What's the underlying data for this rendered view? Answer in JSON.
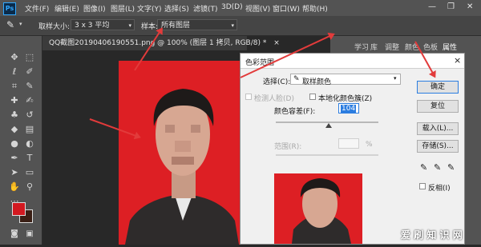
{
  "menubar": {
    "logo": "Ps",
    "items": [
      "文件(F)",
      "编辑(E)",
      "图像(I)",
      "图层(L)",
      "文字(Y)",
      "选择(S)",
      "滤镜(T)",
      "3D(D)",
      "视图(V)",
      "窗口(W)",
      "帮助(H)"
    ],
    "window_buttons": [
      "—",
      "❐",
      "✕"
    ]
  },
  "options": {
    "sample_size_label": "取样大小:",
    "sample_size_value": "3 x 3 平均",
    "sample_label": "样本:",
    "sample_value": "所有图层"
  },
  "document": {
    "tab_title": "QQ截图20190406190551.png @ 100% (图层 1 拷贝, RGB/8) *",
    "close": "×"
  },
  "panels": {
    "tabs": [
      "学习",
      "库",
      "调整",
      "颜色",
      "色板",
      "属性"
    ]
  },
  "dialog": {
    "title": "色彩范围",
    "close": "×",
    "select_label": "选择(C):",
    "select_value": "取样颜色",
    "detect_faces_label": "检测人脸(D)",
    "localized_label": "本地化颜色簇(Z)",
    "fuzziness_label": "颜色容差(F):",
    "fuzziness_value": "104",
    "range_label": "范围(R):",
    "range_unit": "%",
    "buttons": {
      "ok": "确定",
      "reset": "复位",
      "load": "载入(L)...",
      "save": "存储(S)..."
    },
    "invert_label": "反相(I)"
  },
  "colors": {
    "foreground": "#d21920",
    "background": "#3a1f15",
    "photo_bg": "#dd1f24",
    "annotation": "#e23b3b"
  },
  "watermark": "爱 刷 知 识 网"
}
